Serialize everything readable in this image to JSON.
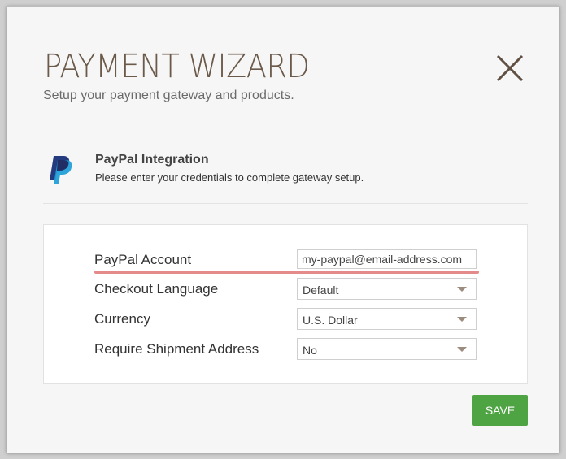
{
  "modal": {
    "title": "PAYMENT WIZARD",
    "subtitle": "Setup your payment gateway and products."
  },
  "icons": {
    "close": "close-icon",
    "paypal": "paypal-logo-icon",
    "dropdown": "chevron-down-icon"
  },
  "integration": {
    "title": "PayPal Integration",
    "description": "Please enter your credentials to complete gateway setup."
  },
  "form": {
    "fields": [
      {
        "label": "PayPal Account",
        "value": "my-paypal@email-address.com"
      },
      {
        "label": "Checkout Language",
        "value": "Default"
      },
      {
        "label": "Currency",
        "value": "U.S. Dollar"
      },
      {
        "label": "Require Shipment Address",
        "value": "No"
      }
    ]
  },
  "footer": {
    "save_label": "SAVE"
  },
  "colors": {
    "title": "#6b5a4a",
    "save_button": "#4ea443",
    "highlight": "#e58a8a",
    "paypal_dark": "#253b80",
    "paypal_light": "#179bd7"
  }
}
